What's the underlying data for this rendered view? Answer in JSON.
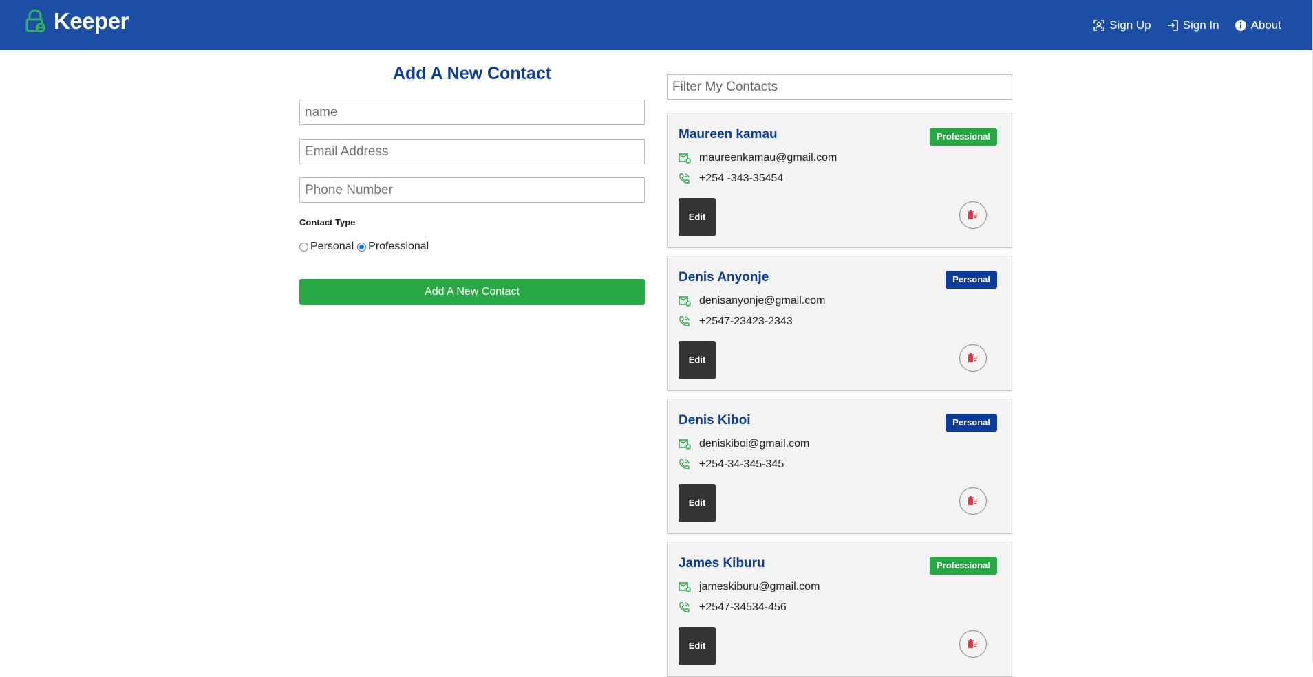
{
  "app": {
    "name": "Keeper"
  },
  "nav": [
    {
      "label": "Sign Up",
      "icon": "signup-icon"
    },
    {
      "label": "Sign In",
      "icon": "signin-icon"
    },
    {
      "label": "About",
      "icon": "info-icon"
    }
  ],
  "form": {
    "title": "Add A New Contact",
    "name_placeholder": "name",
    "email_placeholder": "Email Address",
    "phone_placeholder": "Phone Number",
    "contact_type_label": "Contact Type",
    "option_personal": "Personal",
    "option_professional": "Professional",
    "selected_type": "Professional",
    "submit_label": "Add A New Contact"
  },
  "filter": {
    "placeholder": "Filter My Contacts"
  },
  "contacts": [
    {
      "name": "Maureen kamau",
      "type": "Professional",
      "email": "maureenkamau@gmail.com",
      "phone": "+254 -343-35454",
      "edit_label": "Edit"
    },
    {
      "name": "Denis Anyonje",
      "type": "Personal",
      "email": "denisanyonje@gmail.com",
      "phone": "+2547-23423-2343",
      "edit_label": "Edit"
    },
    {
      "name": "Denis Kiboi",
      "type": "Personal",
      "email": "deniskiboi@gmail.com",
      "phone": "+254-34-345-345",
      "edit_label": "Edit"
    },
    {
      "name": "James Kiburu",
      "type": "Professional",
      "email": "jameskiburu@gmail.com",
      "phone": "+2547-34534-456",
      "edit_label": "Edit"
    }
  ],
  "colors": {
    "navbar": "#1c4ea6",
    "primary_text": "#0c3c9a",
    "success": "#28a745",
    "dark_button": "#343434",
    "danger": "#dc3545"
  }
}
